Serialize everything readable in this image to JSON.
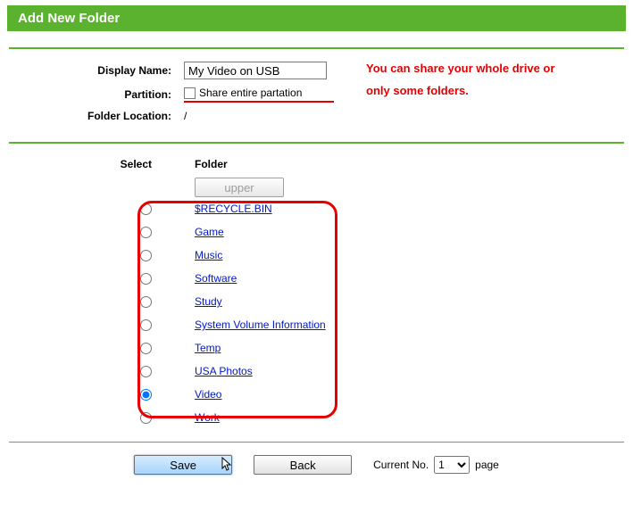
{
  "header": {
    "title": "Add New Folder"
  },
  "form": {
    "display_name_label": "Display Name:",
    "display_name_value": "My Video on USB",
    "partition_label": "Partition:",
    "share_entire_label": "Share entire partation",
    "folder_location_label": "Folder Location:",
    "folder_location_value": "/"
  },
  "note": {
    "line1": "You can share your whole drive or",
    "line2": "only some folders."
  },
  "table": {
    "select_header": "Select",
    "folder_header": "Folder",
    "upper_label": "upper",
    "items": [
      {
        "name": "$RECYCLE.BIN",
        "selected": false
      },
      {
        "name": "Game",
        "selected": false
      },
      {
        "name": "Music",
        "selected": false
      },
      {
        "name": "Software",
        "selected": false
      },
      {
        "name": "Study",
        "selected": false
      },
      {
        "name": "System Volume Information",
        "selected": false
      },
      {
        "name": "Temp",
        "selected": false
      },
      {
        "name": "USA Photos",
        "selected": false
      },
      {
        "name": "Video",
        "selected": true
      },
      {
        "name": "Work",
        "selected": false
      }
    ]
  },
  "footer": {
    "save_label": "Save",
    "back_label": "Back",
    "current_no_label": "Current No.",
    "page_label": "page",
    "page_value": "1"
  }
}
